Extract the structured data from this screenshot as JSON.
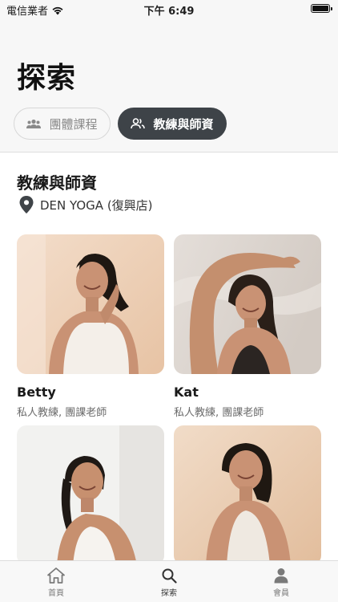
{
  "status": {
    "carrier": "電信業者",
    "time": "下午 6:49"
  },
  "page": {
    "title": "探索"
  },
  "segments": {
    "group_label": "團體課程",
    "coach_label": "教練與師資"
  },
  "section": {
    "title": "教練與師資",
    "location": "DEN YOGA (復興店)"
  },
  "coaches": [
    {
      "name": "Betty",
      "role": "私人教練, 團課老師"
    },
    {
      "name": "Kat",
      "role": "私人教練, 團課老師"
    },
    {
      "name": "",
      "role": ""
    },
    {
      "name": "",
      "role": ""
    }
  ],
  "tabs": [
    {
      "label": "首頁",
      "icon": "home-icon"
    },
    {
      "label": "探索",
      "icon": "search-icon"
    },
    {
      "label": "會員",
      "icon": "person-icon"
    }
  ],
  "colors": {
    "accent_dark": "#3e4348",
    "background": "#f7f7f7"
  }
}
